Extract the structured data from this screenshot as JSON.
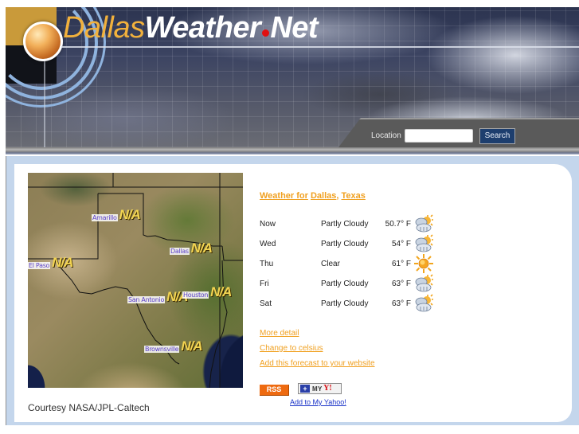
{
  "site": {
    "logo_part1": "Dallas",
    "logo_part2": "Weather",
    "logo_part3": "Net",
    "accent_color": "#f0a020"
  },
  "search": {
    "label": "Location",
    "input_value": "",
    "placeholder": "",
    "button_label": "Search"
  },
  "map": {
    "cities": [
      {
        "name": "Amarillo",
        "temp": "N/A"
      },
      {
        "name": "Dallas",
        "temp": "N/A"
      },
      {
        "name": "El Paso",
        "temp": "N/A"
      },
      {
        "name": "San Antonio",
        "temp": "N/A"
      },
      {
        "name": "Houston",
        "temp": "N/A"
      },
      {
        "name": "Brownsville",
        "temp": "N/A"
      }
    ],
    "courtesy": "Courtesy NASA/JPL-Caltech"
  },
  "weather": {
    "title_prefix": "Weather for",
    "city": "Dallas",
    "separator": ",",
    "state": "Texas",
    "forecast": [
      {
        "day": "Now",
        "condition": "Partly Cloudy",
        "temp": "50.7° F",
        "icon": "partly-cloudy-icon"
      },
      {
        "day": "Wed",
        "condition": "Partly Cloudy",
        "temp": "54° F",
        "icon": "partly-cloudy-icon"
      },
      {
        "day": "Thu",
        "condition": "Clear",
        "temp": "61° F",
        "icon": "sun-icon"
      },
      {
        "day": "Fri",
        "condition": "Partly Cloudy",
        "temp": "63° F",
        "icon": "partly-cloudy-icon"
      },
      {
        "day": "Sat",
        "condition": "Partly Cloudy",
        "temp": "63° F",
        "icon": "partly-cloudy-icon"
      }
    ]
  },
  "links": {
    "more_detail": "More detail",
    "celsius": "Change to celsius",
    "add_forecast": "Add this forecast to your website"
  },
  "badges": {
    "rss": "RSS",
    "myyahoo_plus": "+",
    "myyahoo_my": "MY",
    "myyahoo_y": "Y!",
    "add_to_yahoo": "Add to My Yahoo!"
  }
}
